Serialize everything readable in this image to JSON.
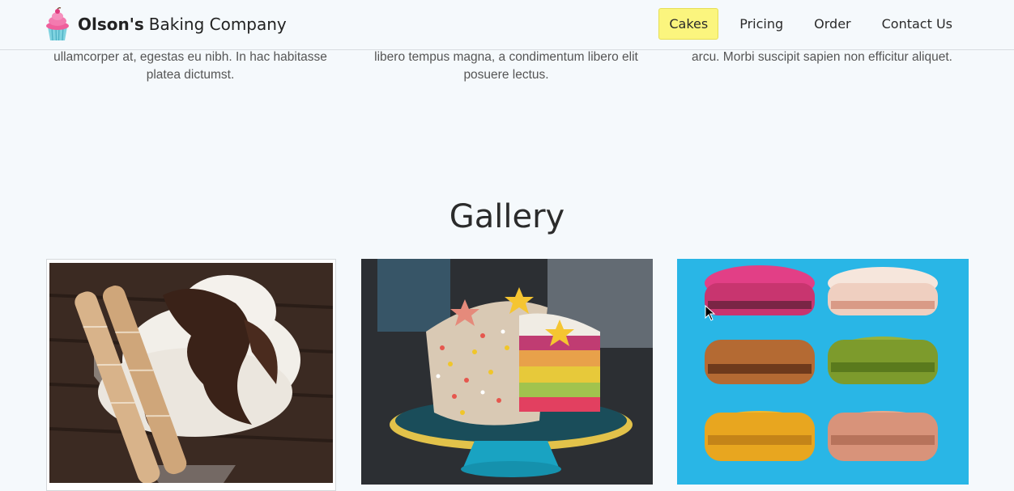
{
  "brand": {
    "name_bold": "Olson's",
    "name_rest": "Baking Company",
    "logo_icon": "cupcake-icon"
  },
  "nav": {
    "items": [
      {
        "label": "Cakes",
        "active": true
      },
      {
        "label": "Pricing",
        "active": false
      },
      {
        "label": "Order",
        "active": false
      },
      {
        "label": "Contact Us",
        "active": false
      }
    ],
    "active_color": "#fbf57e"
  },
  "features": [
    {
      "text": "ullamcorper at, egestas eu nibh. In hac habitasse platea dictumst."
    },
    {
      "text": "libero tempus magna, a condimentum libero elit posuere lectus."
    },
    {
      "text": "arcu. Morbi suscipit sapien non efficitur aliquet."
    }
  ],
  "gallery": {
    "title": "Gallery",
    "images": [
      {
        "subject": "ice cream sundae with wafer rolls"
      },
      {
        "subject": "rainbow layer cake on a cake stand"
      },
      {
        "subject": "stacked colorful macarons"
      }
    ]
  },
  "colors": {
    "background": "#f5f9fc",
    "macaron_backdrop": "#29b6e6"
  }
}
